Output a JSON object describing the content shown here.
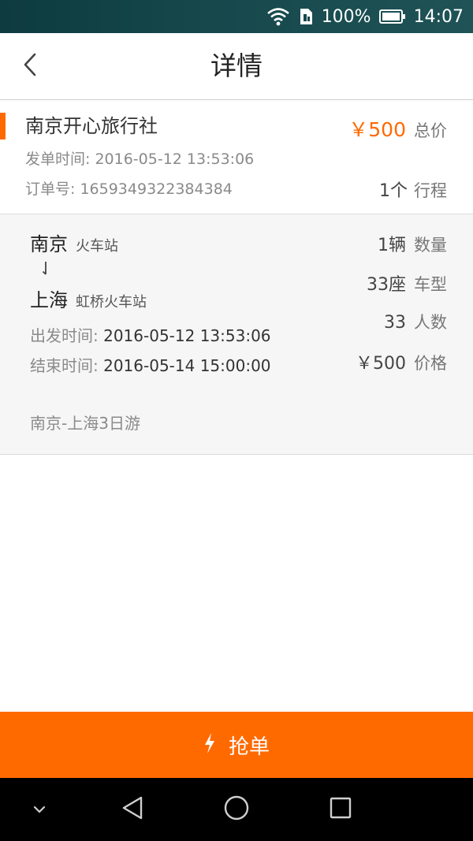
{
  "status_bar": {
    "battery": "100%",
    "time": "14:07"
  },
  "header": {
    "title": "详情"
  },
  "order": {
    "agency": "南京开心旅行社",
    "total_price": "￥500",
    "total_label": "总价",
    "issue_time_label": "发单时间:",
    "issue_time": "2016-05-12 13:53:06",
    "order_no_label": "订单号:",
    "order_no": "1659349322384384",
    "trip_count": "1个",
    "trip_label": "行程"
  },
  "route": {
    "from_city": "南京",
    "from_station": "火车站",
    "to_city": "上海",
    "to_station": "虹桥火车站",
    "depart_label": "出发时间:",
    "depart_time": "2016-05-12 13:53:06",
    "end_label": "结束时间:",
    "end_time": "2016-05-14 15:00:00",
    "specs": [
      {
        "value": "1辆",
        "label": "数量"
      },
      {
        "value": "33座",
        "label": "车型"
      },
      {
        "value": "33",
        "label": "人数"
      },
      {
        "value": "￥500",
        "label": "价格"
      }
    ]
  },
  "description": "南京-上海3日游",
  "action": {
    "label": "抢单"
  },
  "colors": {
    "accent": "#ff6a00",
    "status_bar": "#15474b",
    "nav_bar": "#000000"
  },
  "icons": {
    "back": "chevron-left-icon",
    "action": "lightning-icon",
    "route_arrow": "arrow-down-icon"
  }
}
